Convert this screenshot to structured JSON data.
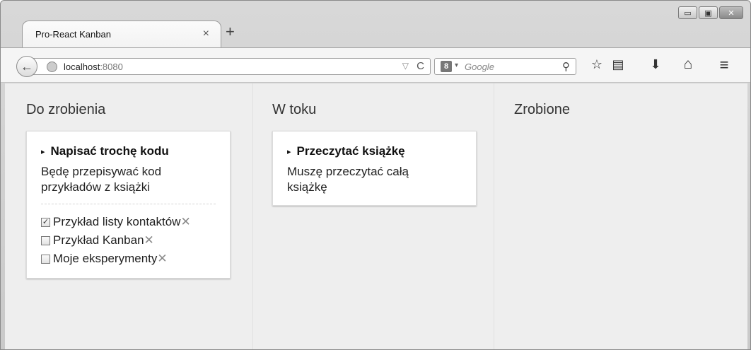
{
  "browser": {
    "tab_title": "Pro-React Kanban",
    "tab_close": "×",
    "new_tab": "+",
    "url_host": "localhost",
    "url_port": ":8080",
    "url_dropdown": "▽",
    "url_reload": "C",
    "search_engine_label": "8",
    "search_dropdown": "▾",
    "search_placeholder": "Google",
    "search_go": "⚲",
    "win_minimize": "▭",
    "win_maximize": "▣",
    "win_close": "✕"
  },
  "toolbar": {
    "bookmark_icon": "☆",
    "reading_list_icon": "▤",
    "download_icon": "⬇",
    "home_icon": "⌂",
    "menu_icon": "≡",
    "back_icon": "←"
  },
  "columns": [
    {
      "title": "Do zrobienia",
      "cards": [
        {
          "title": "Napisać trochę kodu",
          "arrow": "▸",
          "description": "Będę przepisywać kod przykładów z książki",
          "tasks": [
            {
              "name": "Przykład listy kontaktów",
              "done": true
            },
            {
              "name": "Przykład Kanban",
              "done": false
            },
            {
              "name": "Moje eksperymenty",
              "done": false
            }
          ]
        }
      ]
    },
    {
      "title": "W toku",
      "cards": [
        {
          "title": "Przeczytać książkę",
          "arrow": "▸",
          "description": "Muszę przeczytać całą książkę"
        }
      ]
    },
    {
      "title": "Zrobione",
      "cards": []
    }
  ],
  "task_delete_glyph": "✕",
  "checkbox_checked_glyph": "✓"
}
